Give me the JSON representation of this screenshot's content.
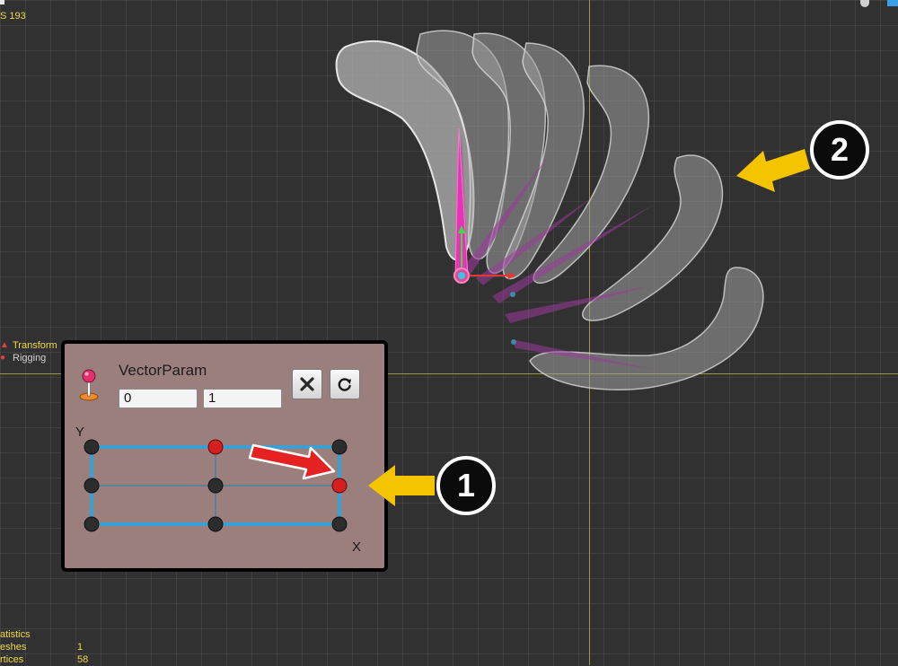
{
  "header": {
    "fps_label": "S 193"
  },
  "menu": [
    {
      "label": "Transform"
    },
    {
      "label": "Rigging"
    }
  ],
  "param_panel": {
    "title": "VectorParam",
    "value_x": "0",
    "value_y": "1",
    "axis_x_label": "X",
    "axis_y_label": "Y",
    "remove_icon": "x-icon",
    "reset_icon": "reset-icon",
    "grid_columns": 3,
    "grid_rows": 3,
    "active_point": "right-middle"
  },
  "callouts": {
    "one": "1",
    "two": "2"
  },
  "stats": {
    "title": "atistics",
    "rows": [
      {
        "name": "eshes",
        "value": "1"
      },
      {
        "name": "rtices",
        "value": "58"
      }
    ]
  },
  "colors": {
    "background": "#313131",
    "panel": "#9b7f7d",
    "accent_yellow": "#f5c400",
    "bone": "#d63aa8",
    "slider_track": "#3b9fd3"
  }
}
